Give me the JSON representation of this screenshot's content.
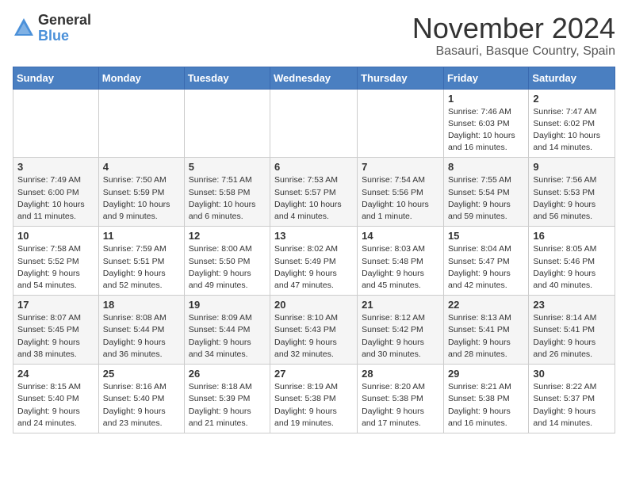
{
  "logo": {
    "text_general": "General",
    "text_blue": "Blue"
  },
  "title": {
    "month": "November 2024",
    "location": "Basauri, Basque Country, Spain"
  },
  "weekdays": [
    "Sunday",
    "Monday",
    "Tuesday",
    "Wednesday",
    "Thursday",
    "Friday",
    "Saturday"
  ],
  "weeks": [
    [
      {
        "day": "",
        "info": ""
      },
      {
        "day": "",
        "info": ""
      },
      {
        "day": "",
        "info": ""
      },
      {
        "day": "",
        "info": ""
      },
      {
        "day": "",
        "info": ""
      },
      {
        "day": "1",
        "info": "Sunrise: 7:46 AM\nSunset: 6:03 PM\nDaylight: 10 hours and 16 minutes."
      },
      {
        "day": "2",
        "info": "Sunrise: 7:47 AM\nSunset: 6:02 PM\nDaylight: 10 hours and 14 minutes."
      }
    ],
    [
      {
        "day": "3",
        "info": "Sunrise: 7:49 AM\nSunset: 6:00 PM\nDaylight: 10 hours and 11 minutes."
      },
      {
        "day": "4",
        "info": "Sunrise: 7:50 AM\nSunset: 5:59 PM\nDaylight: 10 hours and 9 minutes."
      },
      {
        "day": "5",
        "info": "Sunrise: 7:51 AM\nSunset: 5:58 PM\nDaylight: 10 hours and 6 minutes."
      },
      {
        "day": "6",
        "info": "Sunrise: 7:53 AM\nSunset: 5:57 PM\nDaylight: 10 hours and 4 minutes."
      },
      {
        "day": "7",
        "info": "Sunrise: 7:54 AM\nSunset: 5:56 PM\nDaylight: 10 hours and 1 minute."
      },
      {
        "day": "8",
        "info": "Sunrise: 7:55 AM\nSunset: 5:54 PM\nDaylight: 9 hours and 59 minutes."
      },
      {
        "day": "9",
        "info": "Sunrise: 7:56 AM\nSunset: 5:53 PM\nDaylight: 9 hours and 56 minutes."
      }
    ],
    [
      {
        "day": "10",
        "info": "Sunrise: 7:58 AM\nSunset: 5:52 PM\nDaylight: 9 hours and 54 minutes."
      },
      {
        "day": "11",
        "info": "Sunrise: 7:59 AM\nSunset: 5:51 PM\nDaylight: 9 hours and 52 minutes."
      },
      {
        "day": "12",
        "info": "Sunrise: 8:00 AM\nSunset: 5:50 PM\nDaylight: 9 hours and 49 minutes."
      },
      {
        "day": "13",
        "info": "Sunrise: 8:02 AM\nSunset: 5:49 PM\nDaylight: 9 hours and 47 minutes."
      },
      {
        "day": "14",
        "info": "Sunrise: 8:03 AM\nSunset: 5:48 PM\nDaylight: 9 hours and 45 minutes."
      },
      {
        "day": "15",
        "info": "Sunrise: 8:04 AM\nSunset: 5:47 PM\nDaylight: 9 hours and 42 minutes."
      },
      {
        "day": "16",
        "info": "Sunrise: 8:05 AM\nSunset: 5:46 PM\nDaylight: 9 hours and 40 minutes."
      }
    ],
    [
      {
        "day": "17",
        "info": "Sunrise: 8:07 AM\nSunset: 5:45 PM\nDaylight: 9 hours and 38 minutes."
      },
      {
        "day": "18",
        "info": "Sunrise: 8:08 AM\nSunset: 5:44 PM\nDaylight: 9 hours and 36 minutes."
      },
      {
        "day": "19",
        "info": "Sunrise: 8:09 AM\nSunset: 5:44 PM\nDaylight: 9 hours and 34 minutes."
      },
      {
        "day": "20",
        "info": "Sunrise: 8:10 AM\nSunset: 5:43 PM\nDaylight: 9 hours and 32 minutes."
      },
      {
        "day": "21",
        "info": "Sunrise: 8:12 AM\nSunset: 5:42 PM\nDaylight: 9 hours and 30 minutes."
      },
      {
        "day": "22",
        "info": "Sunrise: 8:13 AM\nSunset: 5:41 PM\nDaylight: 9 hours and 28 minutes."
      },
      {
        "day": "23",
        "info": "Sunrise: 8:14 AM\nSunset: 5:41 PM\nDaylight: 9 hours and 26 minutes."
      }
    ],
    [
      {
        "day": "24",
        "info": "Sunrise: 8:15 AM\nSunset: 5:40 PM\nDaylight: 9 hours and 24 minutes."
      },
      {
        "day": "25",
        "info": "Sunrise: 8:16 AM\nSunset: 5:40 PM\nDaylight: 9 hours and 23 minutes."
      },
      {
        "day": "26",
        "info": "Sunrise: 8:18 AM\nSunset: 5:39 PM\nDaylight: 9 hours and 21 minutes."
      },
      {
        "day": "27",
        "info": "Sunrise: 8:19 AM\nSunset: 5:38 PM\nDaylight: 9 hours and 19 minutes."
      },
      {
        "day": "28",
        "info": "Sunrise: 8:20 AM\nSunset: 5:38 PM\nDaylight: 9 hours and 17 minutes."
      },
      {
        "day": "29",
        "info": "Sunrise: 8:21 AM\nSunset: 5:38 PM\nDaylight: 9 hours and 16 minutes."
      },
      {
        "day": "30",
        "info": "Sunrise: 8:22 AM\nSunset: 5:37 PM\nDaylight: 9 hours and 14 minutes."
      }
    ]
  ]
}
